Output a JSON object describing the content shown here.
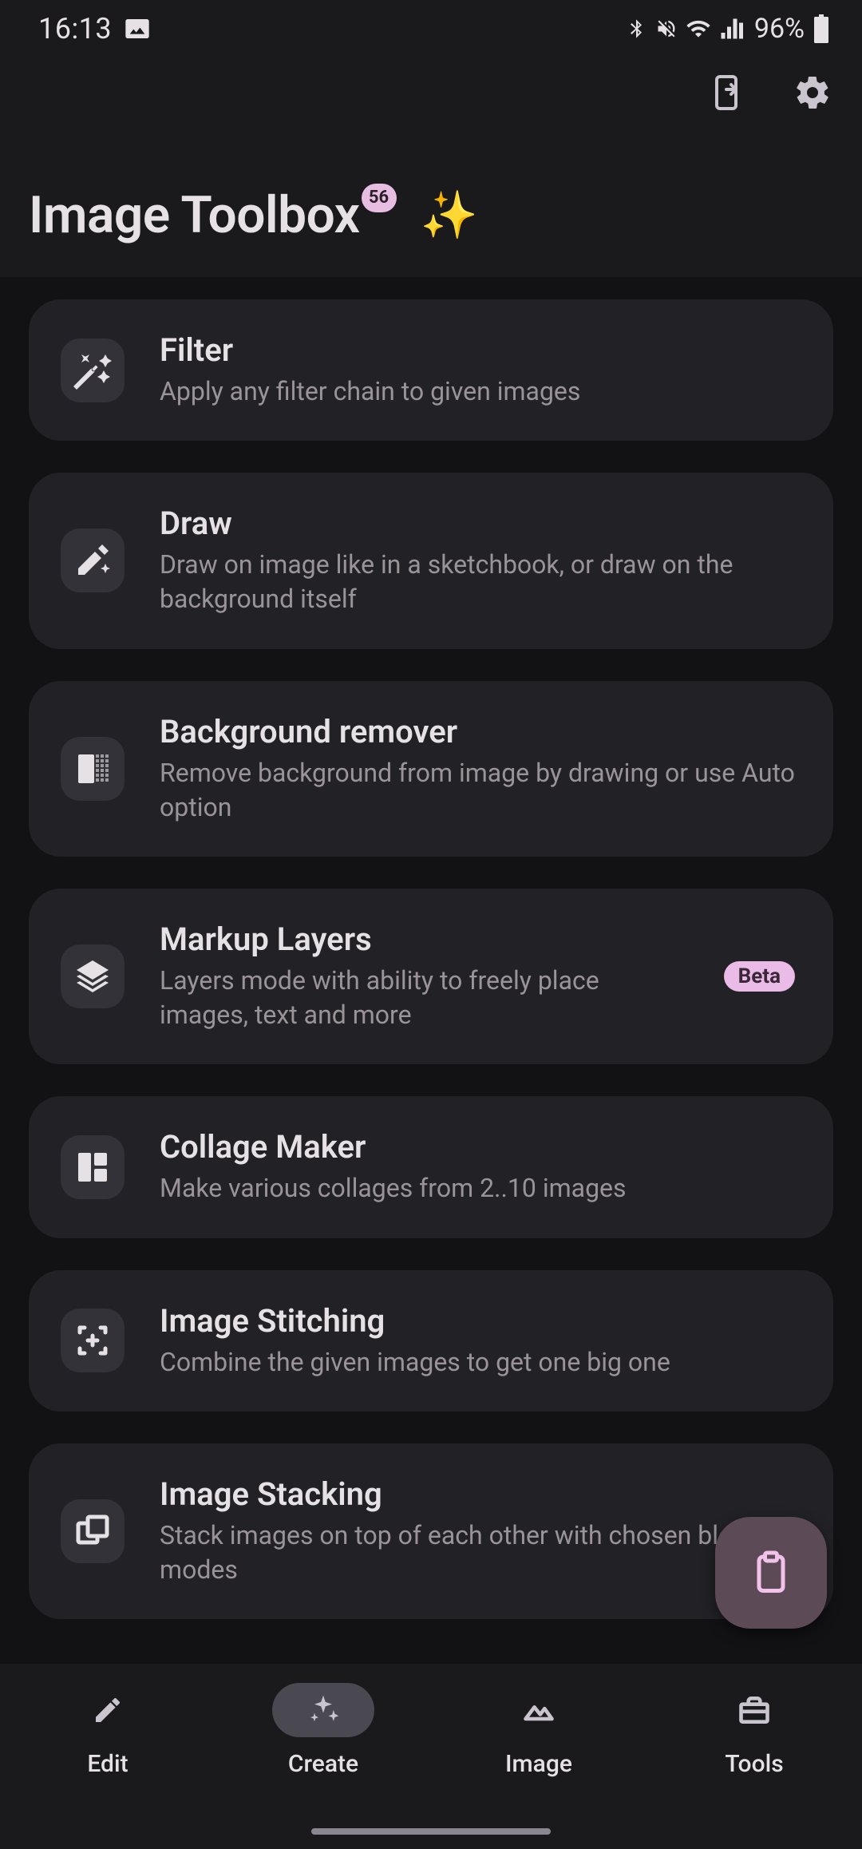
{
  "status": {
    "time": "16:13",
    "battery_pct": "96%"
  },
  "header": {
    "title": "Image Toolbox",
    "badge": "56",
    "emoji": "✨"
  },
  "cards": [
    {
      "id": "filter",
      "title": "Filter",
      "subtitle": "Apply any filter chain to given images"
    },
    {
      "id": "draw",
      "title": "Draw",
      "subtitle": "Draw on image like in a sketchbook, or draw on the background itself"
    },
    {
      "id": "bg_remover",
      "title": "Background remover",
      "subtitle": "Remove background from image by drawing or use Auto option"
    },
    {
      "id": "markup_layers",
      "title": "Markup Layers",
      "subtitle": "Layers mode with ability to freely place images, text and more",
      "badge": "Beta"
    },
    {
      "id": "collage",
      "title": "Collage Maker",
      "subtitle": "Make various collages from 2..10 images"
    },
    {
      "id": "stitching",
      "title": "Image Stitching",
      "subtitle": "Combine the given images to get one big one"
    },
    {
      "id": "stacking",
      "title": "Image Stacking",
      "subtitle": "Stack images on top of each other with chosen blend modes"
    }
  ],
  "nav": {
    "items": [
      {
        "id": "edit",
        "label": "Edit"
      },
      {
        "id": "create",
        "label": "Create"
      },
      {
        "id": "image",
        "label": "Image"
      },
      {
        "id": "tools",
        "label": "Tools"
      }
    ],
    "active": "create"
  }
}
